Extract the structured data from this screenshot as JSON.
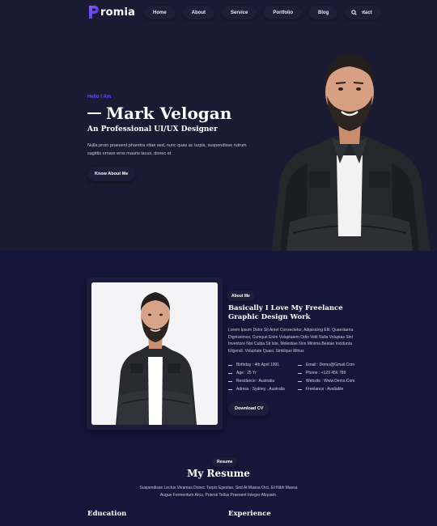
{
  "brand": {
    "logo_letter": "P",
    "name": "romia",
    "accent": "#6c49e8"
  },
  "nav": {
    "items": [
      "Home",
      "About",
      "Service",
      "Portfolio",
      "Blog",
      "Contact"
    ],
    "search_icon": "search-icon"
  },
  "hero": {
    "greeting": "Hello I Am",
    "name": "Mark Velogan",
    "role": "An Professional UI/UX Designer",
    "description": "Nulla proin praesent pharetra vitae sed, nunc quas ac turpis, suspendisse rutrum sagittis ornare eros mauris lacus, donec et",
    "button": "Know About Me"
  },
  "about": {
    "tag": "About Me",
    "title": "Basically I Love My Freelance Graphic Design Work",
    "description": "Lorem Ipsum Dolor Sit Amet Consectetur, Adipisicing Elit. Quaestarna Dignissimos, Cumque Enim Voluptatem Odio Velit Nulla Voluptas Sint Inventore Nisi Culpa Sit Iste, Molestiae Non Minima Beatae Incidunta Eligendi. Voluptate Quasi, Similique Minus",
    "info_left": [
      "Birthday : 4th April 1991",
      "Age : 25 Yr",
      "Residance : Australia",
      "Adress : Sydney , Australia"
    ],
    "info_right": [
      "Email : Demo@Gmail.Com",
      "Phone : +123 456 789",
      "Website : Www.Demo.Com",
      "Freelance : Available"
    ],
    "button": "Download CV"
  },
  "resume": {
    "tag": "Resume",
    "title": "My Resume",
    "description": "Suspendisse Lectus Vivamus Donec Turpis Egestas, Sed At Massa Orci, Et Nibh Massa Augue Fermentum Arcu, Potenti Tellus Praesent Integer Aliquam.",
    "col_left": "Education",
    "col_right": "Experience"
  }
}
